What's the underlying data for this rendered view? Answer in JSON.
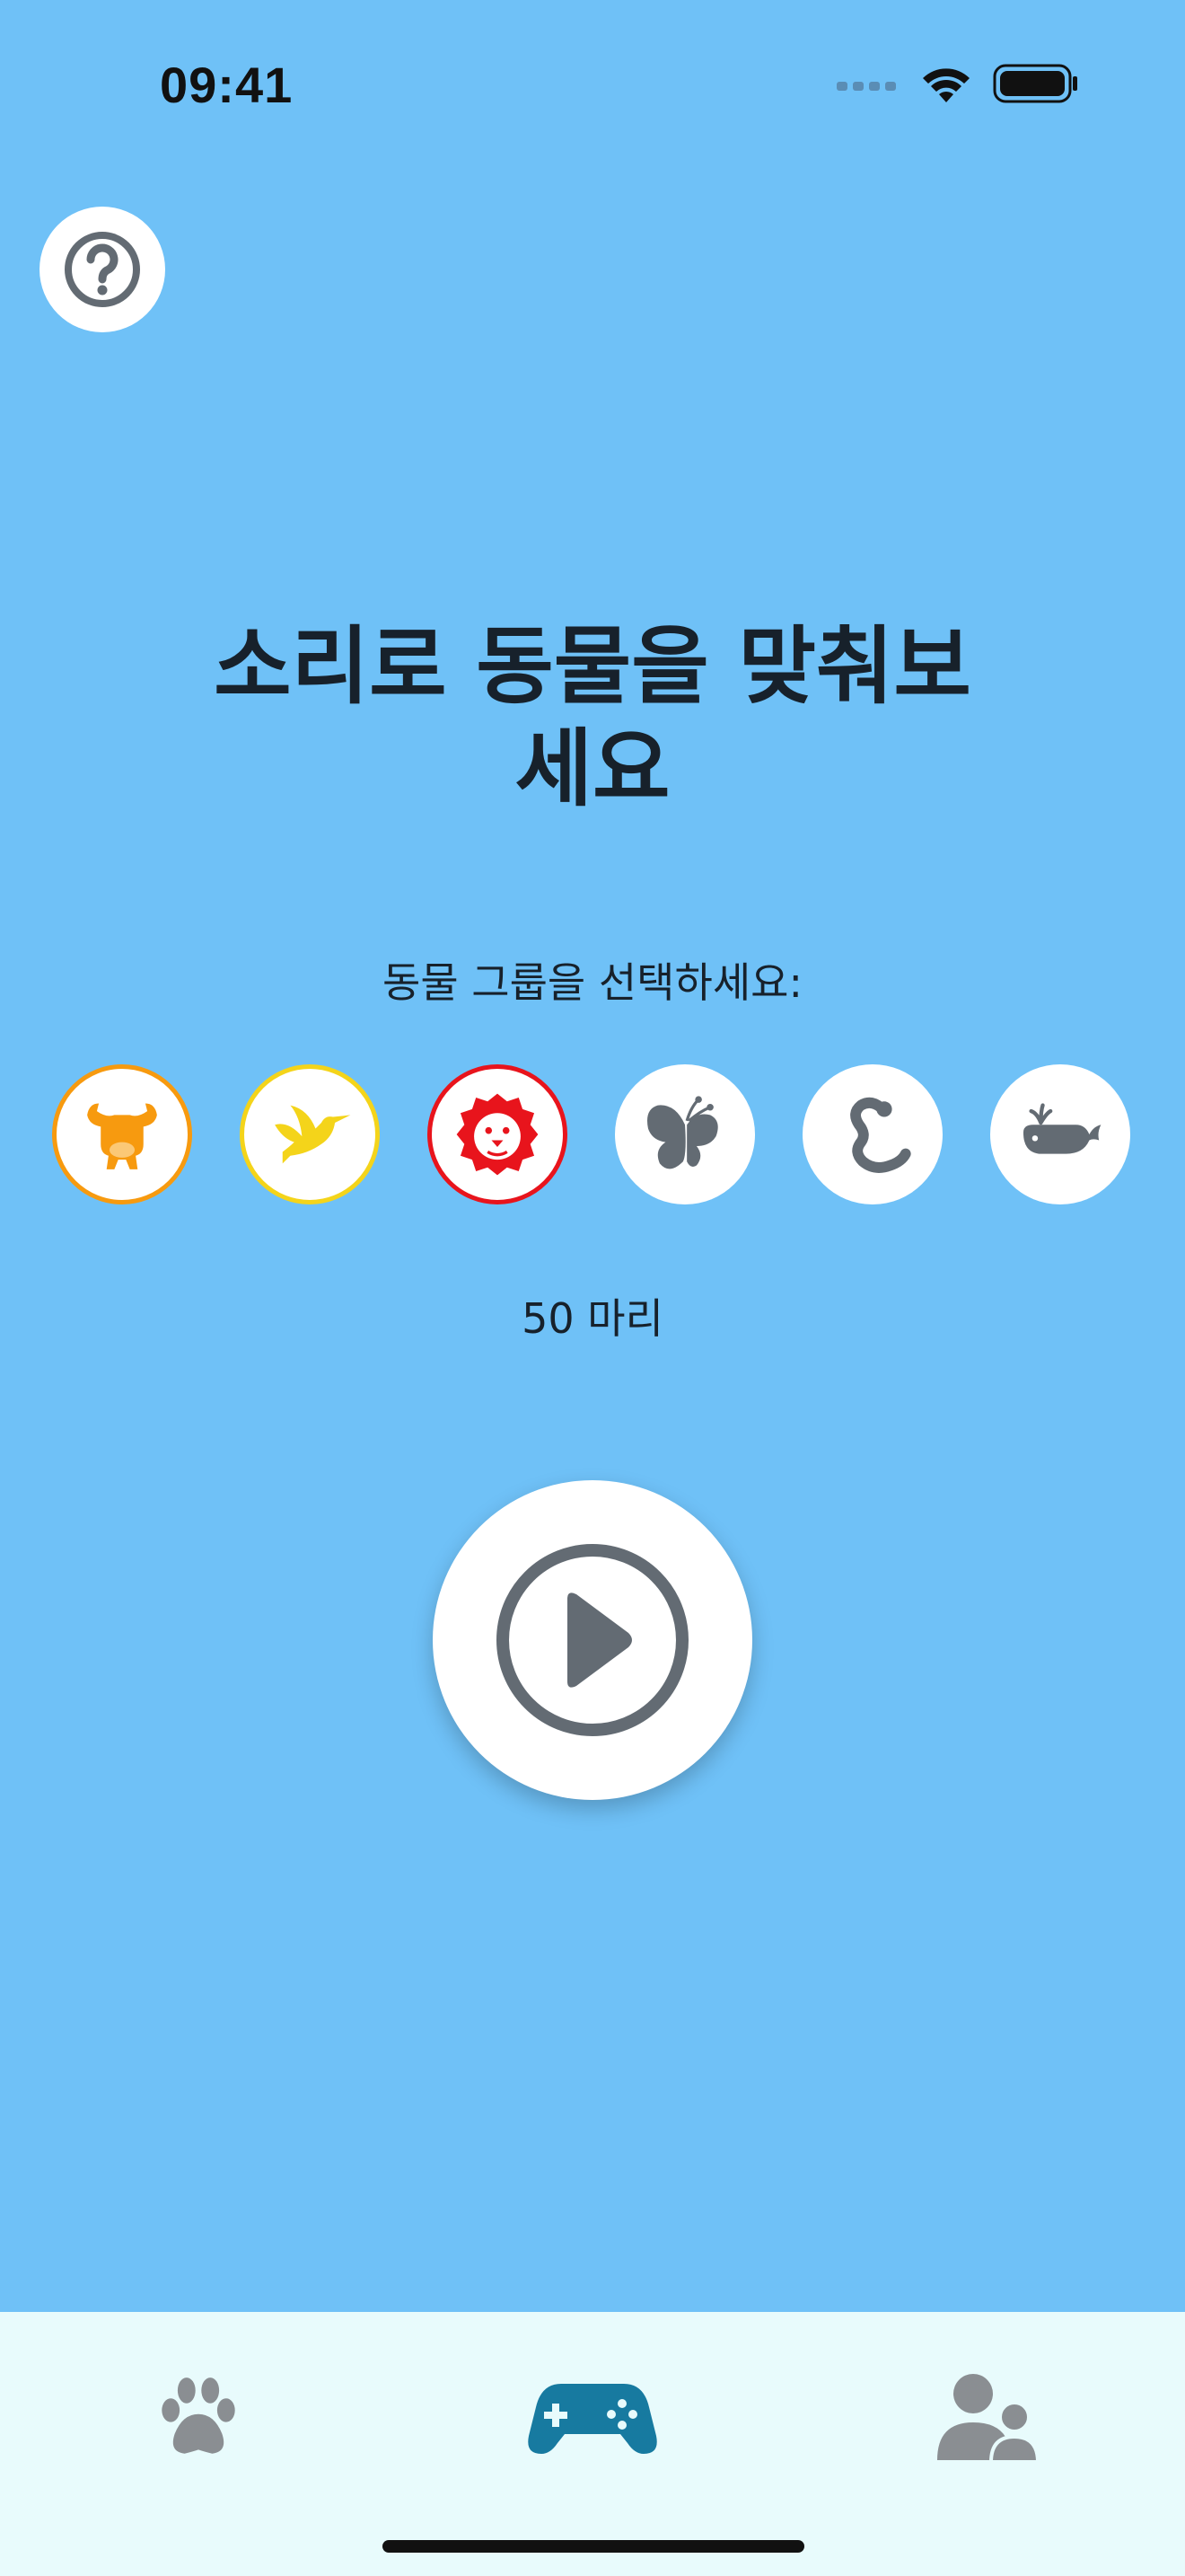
{
  "status_bar": {
    "time": "09:41"
  },
  "main": {
    "title": "소리로 동물을 맞춰보세요",
    "subtitle": "동물 그룹을 선택하세요:",
    "count_text": "50 마리"
  },
  "groups": [
    {
      "name": "farm",
      "icon": "cow-icon",
      "selected": true,
      "ring_color": "#f79a0f",
      "icon_color": "#f79a0f"
    },
    {
      "name": "birds",
      "icon": "bird-icon",
      "selected": true,
      "ring_color": "#f4d41a",
      "icon_color": "#f4d41a"
    },
    {
      "name": "wild",
      "icon": "lion-icon",
      "selected": true,
      "ring_color": "#e8141c",
      "icon_color": "#e8141c"
    },
    {
      "name": "insects",
      "icon": "butterfly-icon",
      "selected": false,
      "icon_color": "#636b73"
    },
    {
      "name": "reptiles",
      "icon": "snake-icon",
      "selected": false,
      "icon_color": "#636b73"
    },
    {
      "name": "sea",
      "icon": "whale-icon",
      "selected": false,
      "icon_color": "#636b73"
    }
  ],
  "tab_bar": {
    "tabs": [
      {
        "icon": "paw-icon",
        "active": false,
        "color": "#8a8e92"
      },
      {
        "icon": "gamepad-icon",
        "active": true,
        "color": "#177aa0"
      },
      {
        "icon": "users-icon",
        "active": false,
        "color": "#8a8e92"
      }
    ]
  },
  "colors": {
    "background": "#6fc1f7",
    "tab_bar_background": "#e8fbfc",
    "icon_gray": "#636b73"
  }
}
